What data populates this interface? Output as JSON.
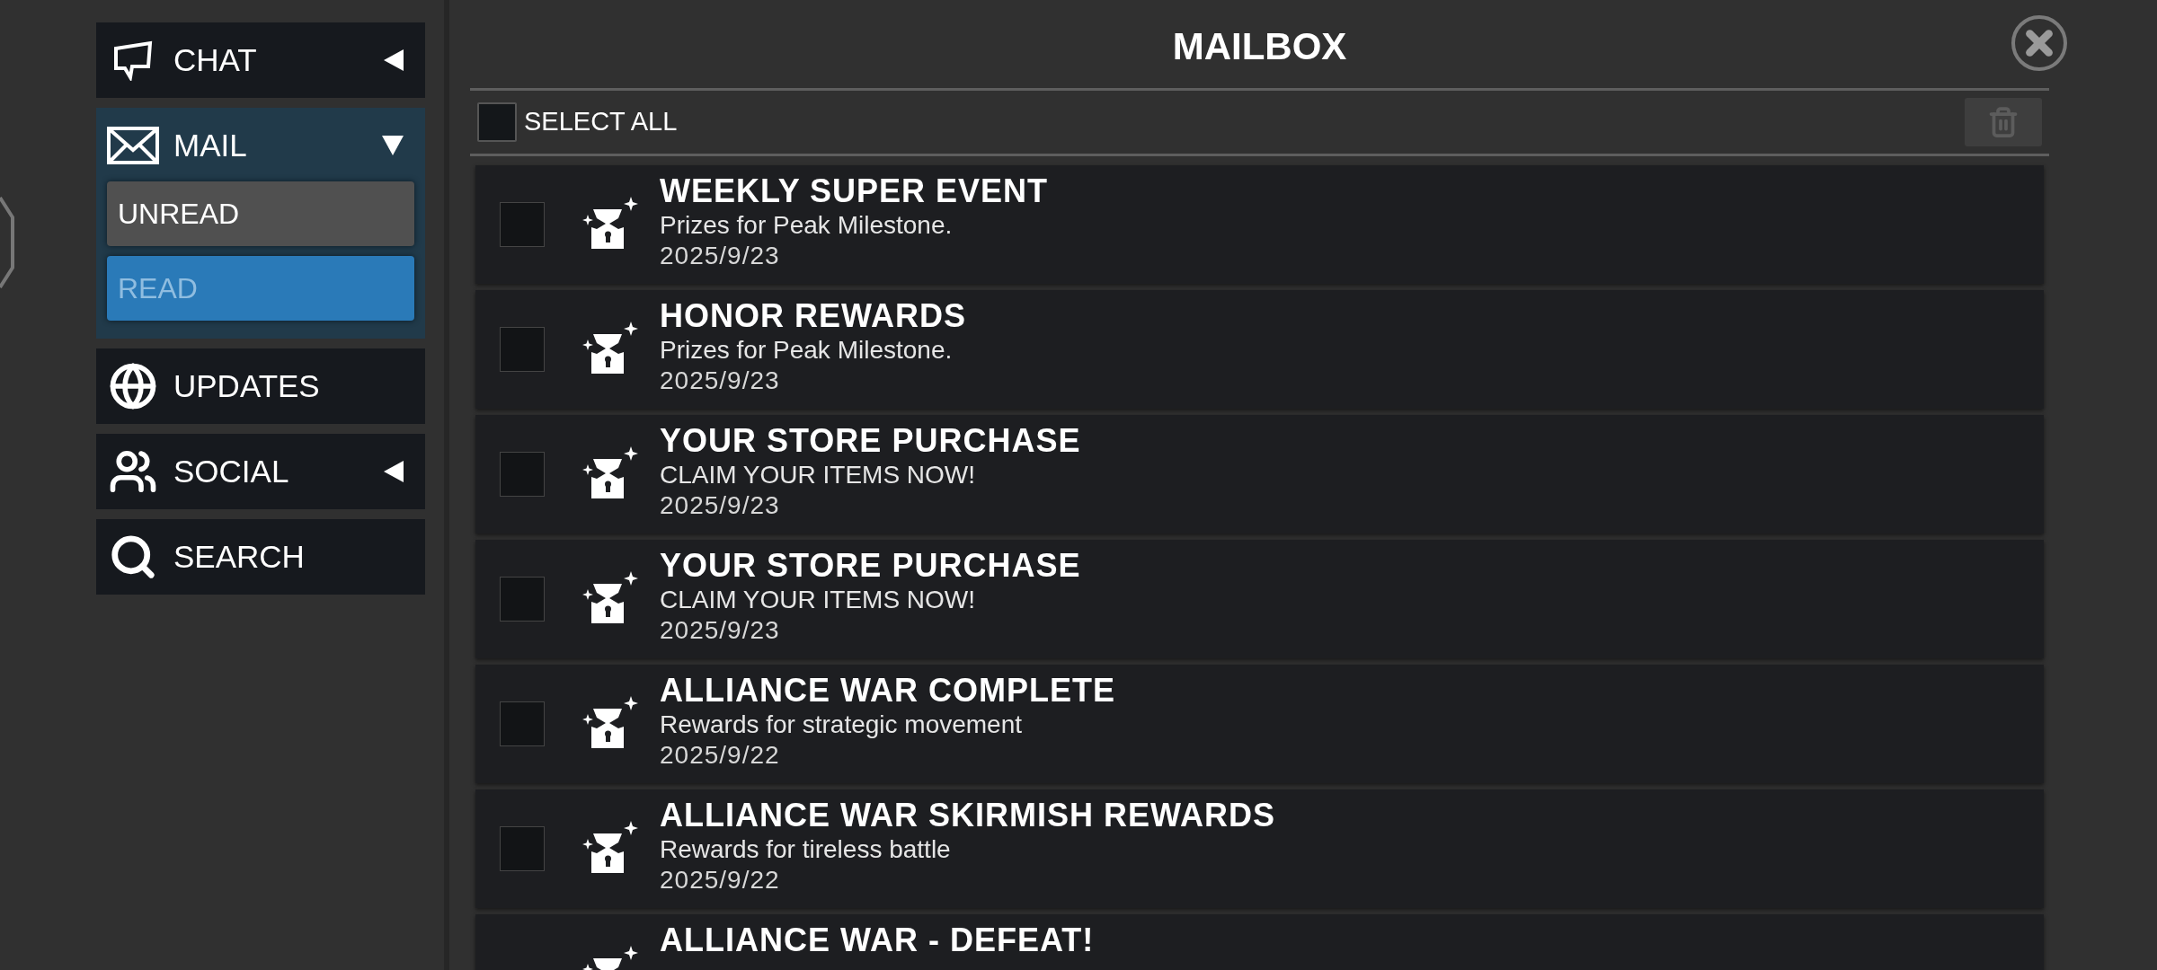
{
  "sidebar": {
    "items": [
      {
        "label": "CHAT",
        "kind": "collapsible",
        "expanded": false
      },
      {
        "label": "MAIL",
        "kind": "collapsible",
        "expanded": true,
        "children": [
          {
            "label": "UNREAD",
            "selected": false
          },
          {
            "label": "READ",
            "selected": true
          }
        ]
      },
      {
        "label": "UPDATES",
        "kind": "plain"
      },
      {
        "label": "SOCIAL",
        "kind": "collapsible",
        "expanded": false
      },
      {
        "label": "SEARCH",
        "kind": "plain"
      }
    ]
  },
  "mailbox": {
    "title": "MAILBOX",
    "select_all": {
      "label": "SELECT ALL",
      "checked": false
    },
    "delete_button": {
      "disabled": true
    },
    "messages": [
      {
        "title": "WEEKLY SUPER EVENT",
        "subtitle": "Prizes for Peak Milestone.",
        "date": "2025/9/23",
        "checked": false
      },
      {
        "title": "HONOR REWARDS",
        "subtitle": "Prizes for Peak Milestone.",
        "date": "2025/9/23",
        "checked": false
      },
      {
        "title": "YOUR STORE PURCHASE",
        "subtitle": "CLAIM YOUR ITEMS NOW!",
        "date": "2025/9/23",
        "checked": false
      },
      {
        "title": "YOUR STORE PURCHASE",
        "subtitle": "CLAIM YOUR ITEMS NOW!",
        "date": "2025/9/23",
        "checked": false
      },
      {
        "title": "ALLIANCE WAR COMPLETE",
        "subtitle": "Rewards for strategic movement",
        "date": "2025/9/22",
        "checked": false
      },
      {
        "title": "ALLIANCE WAR SKIRMISH REWARDS",
        "subtitle": "Rewards for tireless battle",
        "date": "2025/9/22",
        "checked": false
      },
      {
        "title": "ALLIANCE WAR - DEFEAT!"
      }
    ]
  }
}
